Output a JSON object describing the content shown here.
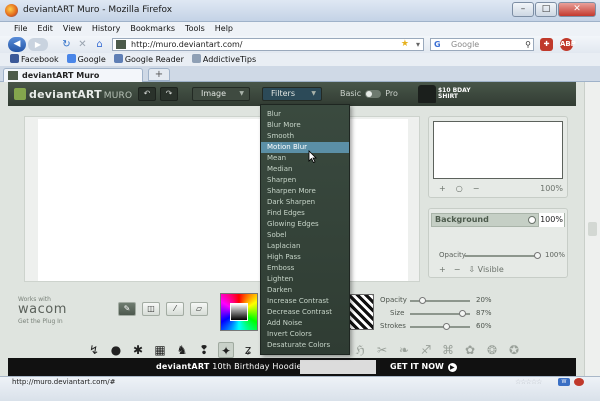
{
  "window": {
    "title": "deviantART Muro - Mozilla Firefox",
    "min": "–",
    "max": "□",
    "close": "✕"
  },
  "menu": [
    "File",
    "Edit",
    "View",
    "History",
    "Bookmarks",
    "Tools",
    "Help"
  ],
  "nav": {
    "url": "http://muro.deviantart.com/",
    "search_placeholder": "Google"
  },
  "bookmarks": [
    "Facebook",
    "Google",
    "Google Reader",
    "AddictiveTips"
  ],
  "tab": {
    "title": "deviantART Muro",
    "new_tab": "+"
  },
  "muro": {
    "logo_main": "deviantART",
    "logo_sub": "MURO",
    "undo": "↶",
    "redo": "↷",
    "image_menu": "Image",
    "filters_menu": "Filters",
    "mode_basic": "Basic",
    "mode_pro": "Pro",
    "promo": "$10 BDAY SHIRT",
    "filters": [
      "Blur",
      "Blur More",
      "Smooth",
      "Motion Blur",
      "Mean",
      "Median",
      "Sharpen",
      "Sharpen More",
      "Dark Sharpen",
      "Find Edges",
      "Glowing Edges",
      "Sobel",
      "Laplacian",
      "High Pass",
      "Emboss",
      "Lighten",
      "Darken",
      "Increase Contrast",
      "Decrease Contrast",
      "Add Noise",
      "Invert Colors",
      "Desaturate Colors"
    ],
    "filters_hovered": "Motion Blur",
    "preview": {
      "zoom_in": "+",
      "zoom_reset": "○",
      "zoom_out": "−",
      "zoom_pct": "100%"
    },
    "layers": {
      "name": "Background",
      "opacity_pct": "100%",
      "opacity_label": "Opacity",
      "opacity_value": "100%",
      "opacity_fraction": 1.0,
      "add": "+",
      "remove": "−",
      "visible": "⇩ Visible"
    },
    "wacom": {
      "works_with": "Works with",
      "brand": "wacom",
      "plug": "Get the Plug In"
    },
    "tools": {
      "brush": "✎",
      "eraser": "◫",
      "eyedropper": "⁄",
      "smudge": "▱"
    },
    "sliders": [
      {
        "label": "Opacity",
        "value": "20%",
        "fraction": 0.2
      },
      {
        "label": "Size",
        "value": "87%",
        "fraction": 0.87
      },
      {
        "label": "Strokes",
        "value": "60%",
        "fraction": 0.6
      }
    ],
    "brushes": [
      "↯",
      "●",
      "✱",
      "▦",
      "♞",
      "❢",
      "✦",
      "ʑ"
    ],
    "brushes_faded": [
      "ℌ",
      "✂",
      "❧",
      "♐",
      "⌘",
      "✿",
      "❂",
      "✪"
    ],
    "banner": {
      "text_brand": "deviantART",
      "text_rest": " 10th Birthday Hoodie",
      "cta": "GET IT NOW"
    }
  },
  "status": {
    "url": "http://muro.deviantart.com/#",
    "stars": "☆☆☆☆☆"
  }
}
